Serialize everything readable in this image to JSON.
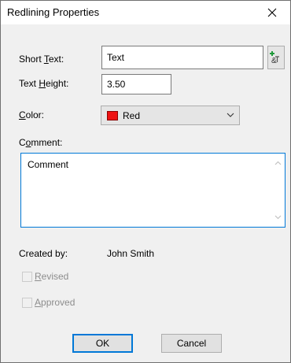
{
  "window": {
    "title": "Redlining Properties"
  },
  "form": {
    "short_text": {
      "label_pre": "Short ",
      "label_key": "T",
      "label_post": "ext:",
      "value": "Text"
    },
    "text_height": {
      "label_pre": "Text ",
      "label_key": "H",
      "label_post": "eight:",
      "value": "3.50"
    },
    "color": {
      "label_pre": "",
      "label_key": "C",
      "label_post": "olor:",
      "value": "Red",
      "swatch": "#ee1111"
    },
    "comment": {
      "label_pre": "C",
      "label_key": "o",
      "label_post": "mment:",
      "value": "Comment"
    },
    "created_by": {
      "label": "Created by:",
      "value": "John Smith"
    },
    "revised": {
      "label_key": "R",
      "label_post": "evised",
      "checked": false,
      "enabled": false
    },
    "approved": {
      "label_key": "A",
      "label_post": "pproved",
      "checked": false,
      "enabled": false
    }
  },
  "buttons": {
    "ok": "OK",
    "cancel": "Cancel"
  },
  "colors": {
    "accent": "#0078d7",
    "disabled_text": "#8d8d8d"
  }
}
